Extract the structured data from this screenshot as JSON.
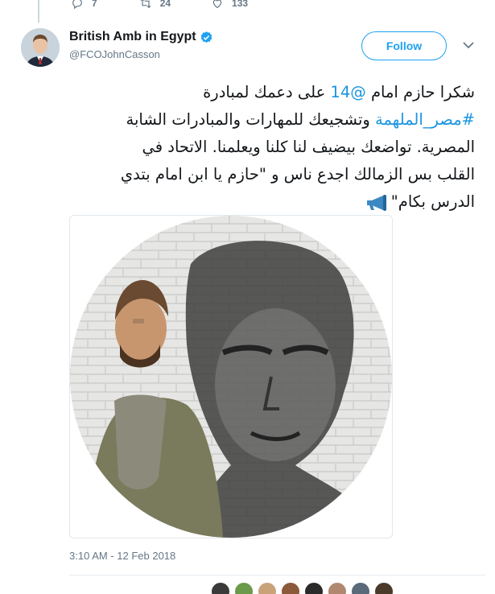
{
  "prev_tweet": {
    "replies": "7",
    "retweets": "24",
    "likes": "133"
  },
  "author": {
    "display_name": "British Amb in Egypt",
    "handle": "@FCOJohnCasson",
    "verified": true
  },
  "follow_label": "Follow",
  "tweet": {
    "line1_a": "شكرا حازم امام ",
    "mention": "@14",
    "line1_b": " على دعمك لمبادرة",
    "hashtag": "#مصر_الملهمة",
    "line2_b": " وتشجيعك للمهارات والمبادرات الشابة",
    "line3": "المصرية. تواضعك بيضيف لنا كلنا ويعلمنا. الاتحاد في",
    "line4": "القلب بس الزمالك اجدع ناس و \"حازم يا ابن امام بتدي",
    "line5": "الدرس بكام\""
  },
  "timestamp": "3:10 AM - 12 Feb 2018",
  "colors": {
    "accent": "#1da1f2",
    "link": "#1b95e0",
    "muted": "#657786"
  },
  "icons": [
    "reply-icon",
    "retweet-icon",
    "like-icon",
    "verified-badge-icon",
    "chevron-down-icon",
    "megaphone-emoji"
  ]
}
